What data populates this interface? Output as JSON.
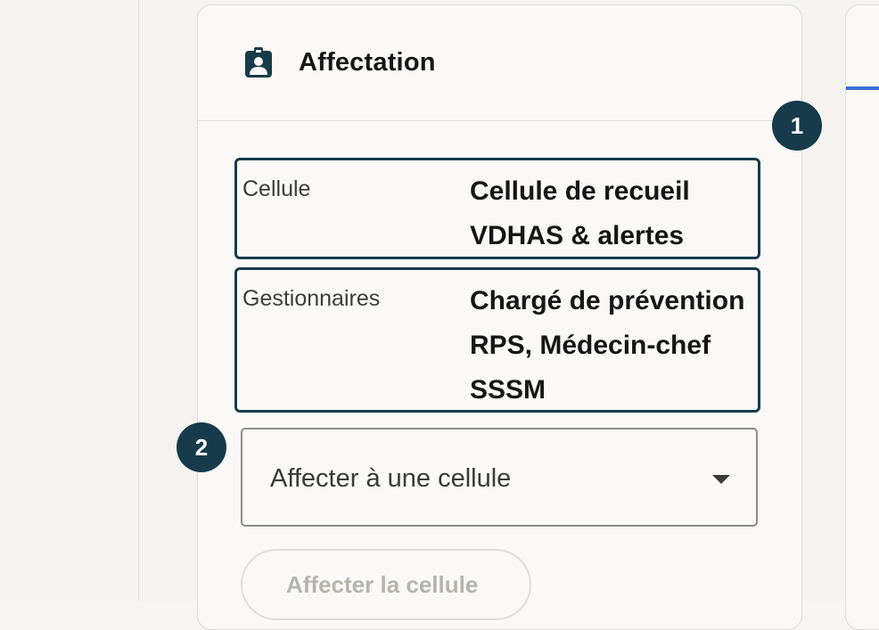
{
  "card": {
    "title": "Affectation",
    "title_icon": "clipboard-user-icon"
  },
  "steps": {
    "step1": "1",
    "step2": "2"
  },
  "info": {
    "cellule_label": "Cellule",
    "cellule_value": "Cellule de recueil VDHAS & alertes",
    "gestionnaires_label": "Gestionnaires",
    "gestionnaires_value": "Chargé de prévention RPS, Médecin-chef SSSM"
  },
  "assign": {
    "select_placeholder": "Affecter à une cellule",
    "select_icon": "chevron-down-icon",
    "button_label": "Affecter la cellule"
  },
  "colors": {
    "accent": "#173b4a",
    "tab_indicator": "#3a6fd1",
    "background": "#f7f6f4"
  }
}
